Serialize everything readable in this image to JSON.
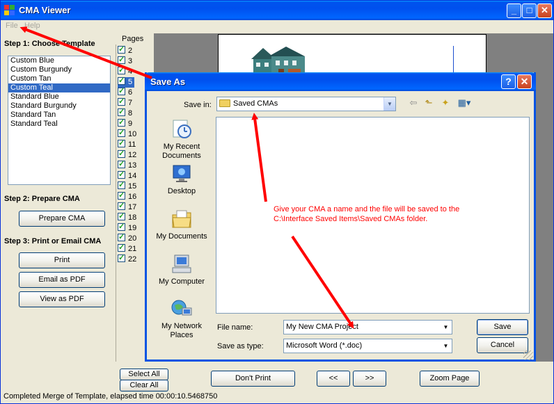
{
  "window": {
    "title": "CMA Viewer"
  },
  "menu": {
    "file": "File",
    "help": "Help"
  },
  "step1": {
    "heading": "Step 1: Choose Template",
    "templates": [
      "Custom Blue",
      "Custom Burgundy",
      "Custom Tan",
      "Custom Teal",
      "Standard Blue",
      "Standard Burgundy",
      "Standard Tan",
      "Standard Teal"
    ],
    "selected_template": "Custom Teal"
  },
  "step2": {
    "heading": "Step 2: Prepare CMA",
    "prepare_button": "Prepare CMA"
  },
  "step3": {
    "heading": "Step 3: Print or Email CMA",
    "print_button": "Print",
    "email_button": "Email as PDF",
    "view_button": "View as PDF"
  },
  "pages": {
    "label": "Pages",
    "items": [
      "2",
      "3",
      "4",
      "5",
      "6",
      "7",
      "8",
      "9",
      "10",
      "11",
      "12",
      "13",
      "14",
      "15",
      "16",
      "17",
      "18",
      "19",
      "20",
      "21",
      "22"
    ],
    "selected": "5"
  },
  "bottom": {
    "select_all": "Select All",
    "clear_all": "Clear All",
    "dont_print": "Don't Print",
    "prev": "<<",
    "next": ">>",
    "zoom_page": "Zoom Page"
  },
  "status": "Completed Merge of Template, elapsed time 00:00:10.5468750",
  "dialog": {
    "title": "Save As",
    "save_in_label": "Save in:",
    "save_in_value": "Saved CMAs",
    "places": [
      "My Recent Documents",
      "Desktop",
      "My Documents",
      "My Computer",
      "My Network Places"
    ],
    "file_name_label": "File name:",
    "file_name_value": "My New CMA Project",
    "save_type_label": "Save as type:",
    "save_type_value": "Microsoft Word (*.doc)",
    "save_button": "Save",
    "cancel_button": "Cancel",
    "help_button": "?",
    "close_button": "✕"
  },
  "annotation": {
    "line1": "Give your CMA a name and the file will be saved to the",
    "line2": "C:\\Interface Saved Items\\Saved CMAs folder.",
    "color": "#ff0000"
  },
  "colors": {
    "titlebar": "#0054e3",
    "selection": "#316ac5",
    "preview_bg": "#808080"
  }
}
